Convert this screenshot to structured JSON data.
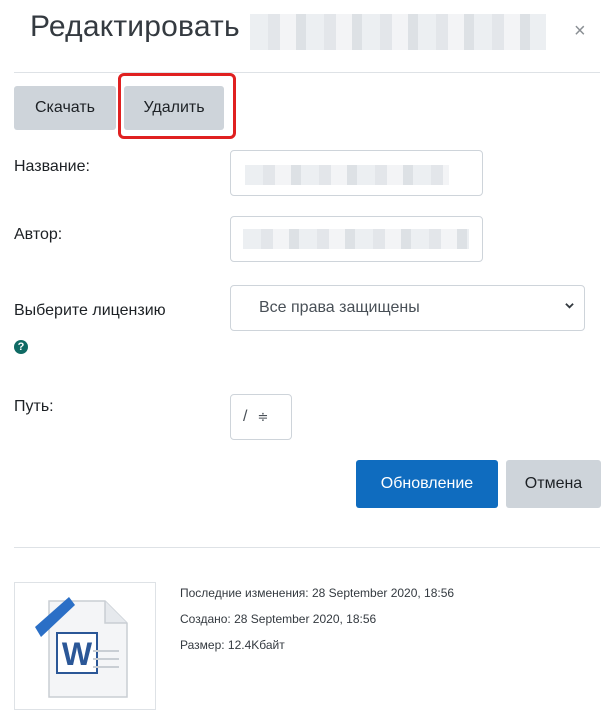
{
  "dialog": {
    "title": "Редактировать",
    "close_label": "×"
  },
  "actions": {
    "download_label": "Скачать",
    "delete_label": "Удалить"
  },
  "form": {
    "name_label": "Название:",
    "name_value": "",
    "author_label": "Автор:",
    "author_value": "",
    "license_label": "Выберите лицензию",
    "license_selected": "Все права защищены",
    "help_icon_text": "?",
    "path_label": "Путь:",
    "path_selected": "/",
    "path_arrows": "≑"
  },
  "buttons": {
    "update_label": "Обновление",
    "cancel_label": "Отмена"
  },
  "file_info": {
    "icon": "word-document-icon",
    "icon_letter": "W",
    "last_modified": "Последние изменения:  28 September 2020, 18:56",
    "created": "Создано:  28 September 2020, 18:56",
    "size": "Размер:  12.4Kбайт"
  },
  "colors": {
    "primary": "#0f6cbf",
    "secondary": "#ced4da",
    "highlight": "#e02020",
    "help": "#0f6a64"
  }
}
